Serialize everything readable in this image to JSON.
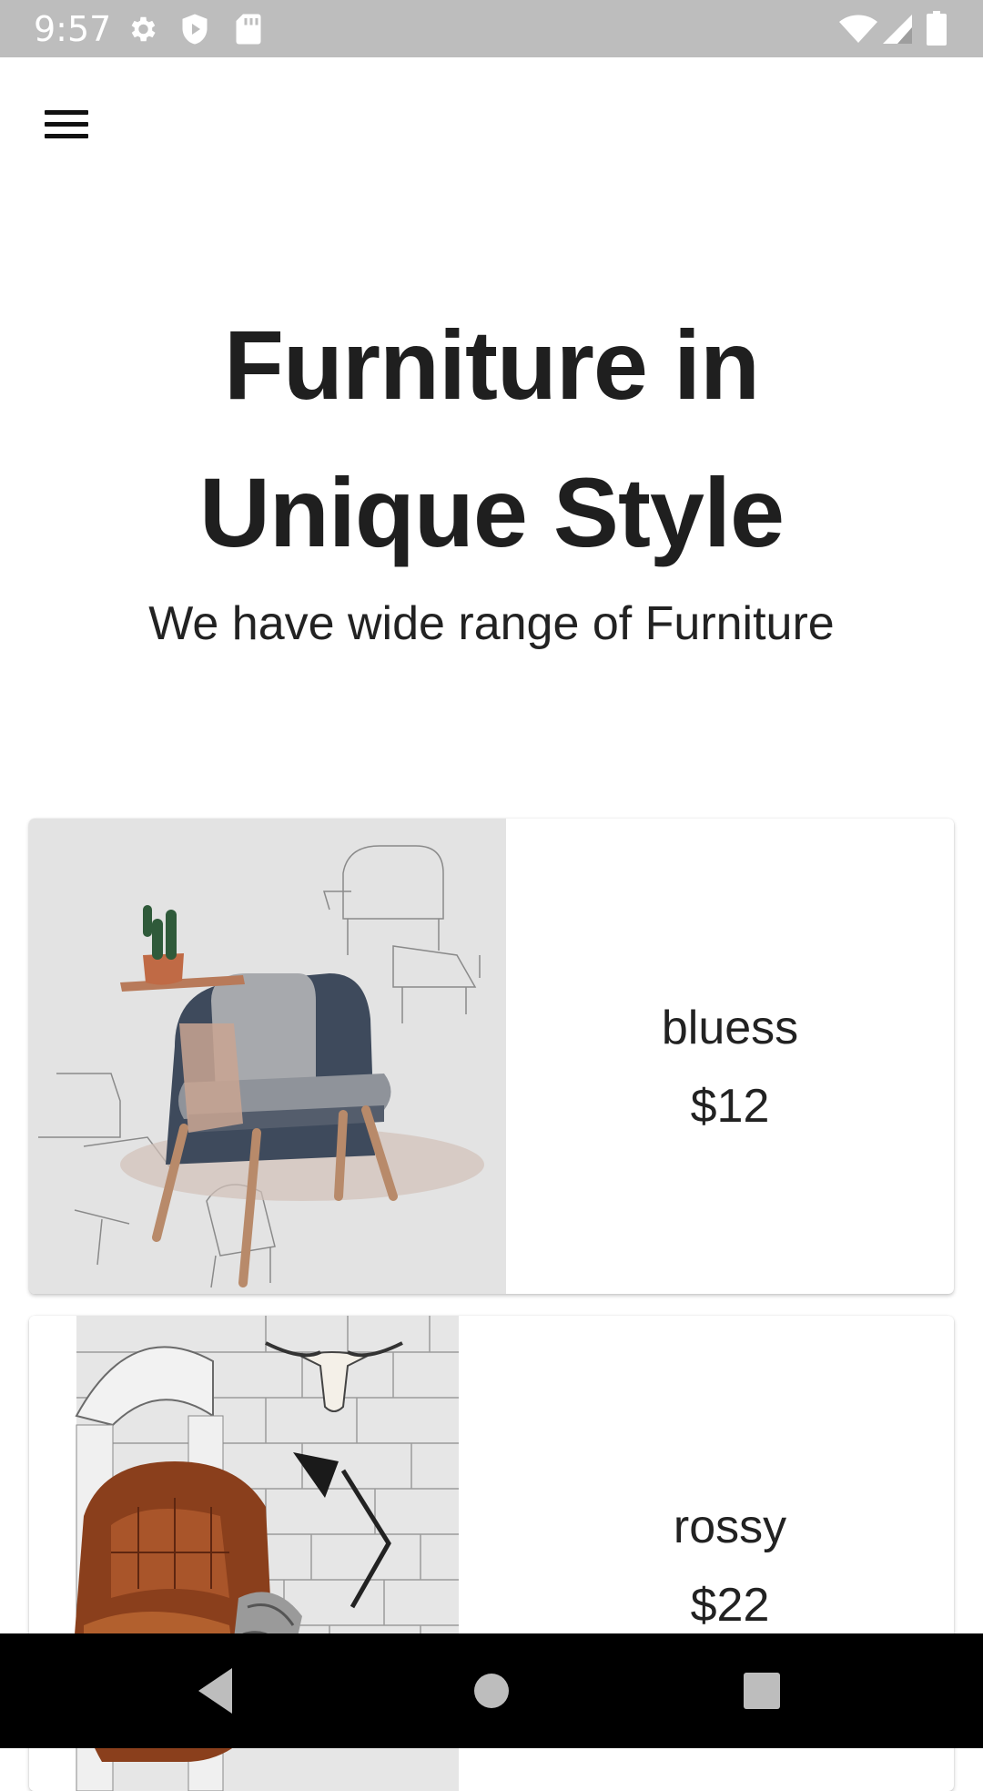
{
  "status_bar": {
    "time": "9:57",
    "icons": [
      "gear-icon",
      "shield-icon",
      "sd-card-icon",
      "wifi-icon",
      "signal-icon",
      "battery-icon"
    ],
    "background": "#bdbdbd"
  },
  "app_bar": {
    "menu_icon": "hamburger-menu-icon"
  },
  "hero": {
    "title_line1": "Furniture in",
    "title_line2": "Unique Style",
    "subtitle": "We have wide range of Furniture"
  },
  "products": [
    {
      "name": "bluess",
      "price": "$12",
      "image": "armchair-sketch-image"
    },
    {
      "name": "rossy",
      "price": "$22",
      "image": "leather-chair-sketch-image"
    }
  ],
  "nav_bar": {
    "icons": [
      "back-icon",
      "home-icon",
      "recents-icon"
    ],
    "background": "#000000"
  }
}
